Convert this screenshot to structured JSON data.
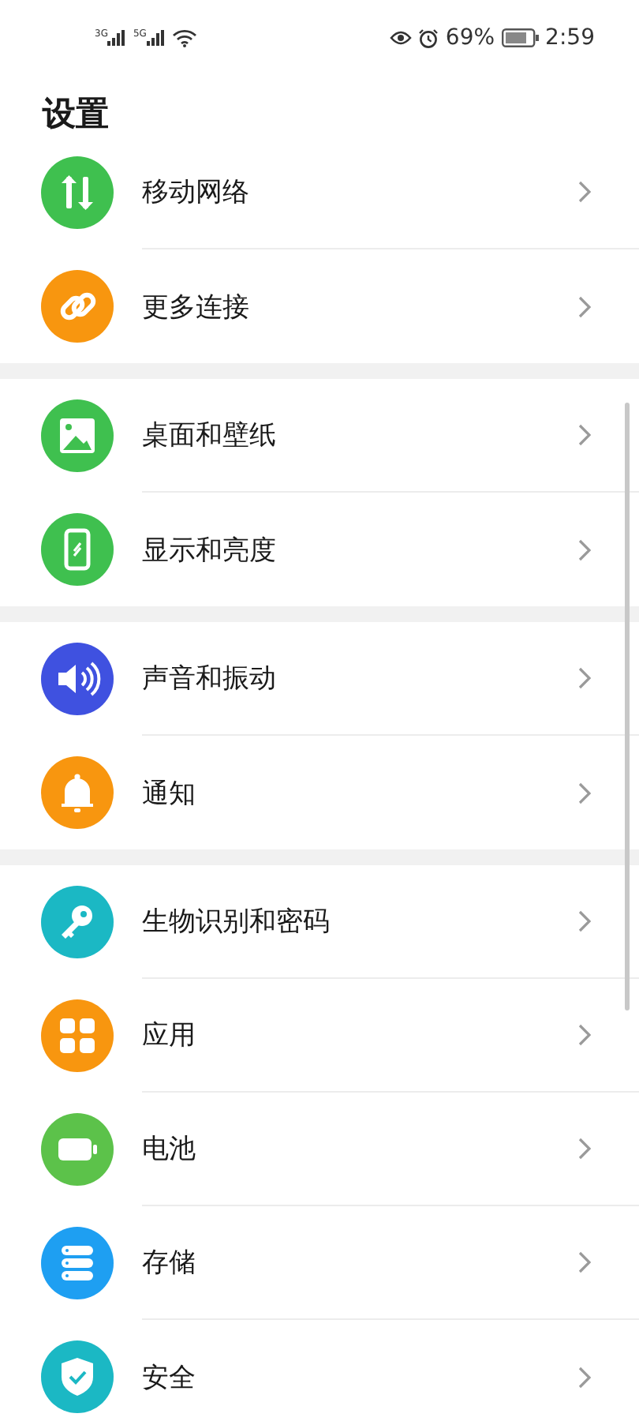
{
  "status_bar": {
    "network_1": "3G",
    "network_2": "5G",
    "battery_percent": "69%",
    "time": "2:59"
  },
  "title": "设置",
  "groups": [
    {
      "items": [
        {
          "label": "移动网络",
          "kind": "network",
          "color": "#3fc04f"
        },
        {
          "label": "更多连接",
          "kind": "link",
          "color": "#f8960f"
        }
      ]
    },
    {
      "items": [
        {
          "label": "桌面和壁纸",
          "kind": "wallpaper",
          "color": "#3fc04f"
        },
        {
          "label": "显示和亮度",
          "kind": "display",
          "color": "#3fc04f"
        }
      ]
    },
    {
      "items": [
        {
          "label": "声音和振动",
          "kind": "sound",
          "color": "#3f51e0"
        },
        {
          "label": "通知",
          "kind": "bell",
          "color": "#f8960f"
        }
      ]
    },
    {
      "items": [
        {
          "label": "生物识别和密码",
          "kind": "key",
          "color": "#1bb8c4"
        },
        {
          "label": "应用",
          "kind": "apps",
          "color": "#f8960f"
        },
        {
          "label": "电池",
          "kind": "battery",
          "color": "#5cc24a"
        },
        {
          "label": "存储",
          "kind": "storage",
          "color": "#1e9ff2"
        },
        {
          "label": "安全",
          "kind": "shield",
          "color": "#1bb8c4"
        }
      ]
    }
  ]
}
